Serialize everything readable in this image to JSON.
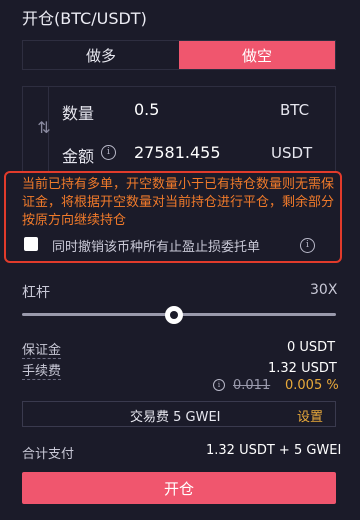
{
  "header": {
    "title": "开仓(BTC/USDT)"
  },
  "tabs": {
    "long": "做多",
    "short": "做空"
  },
  "form": {
    "quantity": {
      "label": "数量",
      "value": "0.5",
      "unit": "BTC"
    },
    "amount": {
      "label": "金额",
      "value": "27581.455",
      "unit": "USDT"
    },
    "swap_icon": "⇅"
  },
  "warning": {
    "text": "当前已持有多单，开空数量小于已有持仓数量则无需保证金，将根据开空数量对当前持仓进行平仓，剩余部分按原方向继续持仓",
    "checkbox_label": "同时撤销该币种所有止盈止损委托单"
  },
  "leverage": {
    "label": "杠杆",
    "value": "30X",
    "slider_fraction": 0.5
  },
  "costs": {
    "margin_label": "保证金",
    "margin_value": "0 USDT",
    "fee_label": "手续费",
    "fee_value": "1.32 USDT",
    "fee_rate_old": "0.011",
    "fee_rate_new": "0.005 %"
  },
  "gas": {
    "text": "交易费 5 GWEI",
    "settings_label": "设置"
  },
  "total": {
    "label": "合计支付",
    "value": "1.32 USDT + 5 GWEI"
  },
  "submit": {
    "label": "开仓"
  },
  "colors": {
    "accent": "#f0566e",
    "warning": "#f07a2a",
    "highlight": "#e8a93a"
  }
}
